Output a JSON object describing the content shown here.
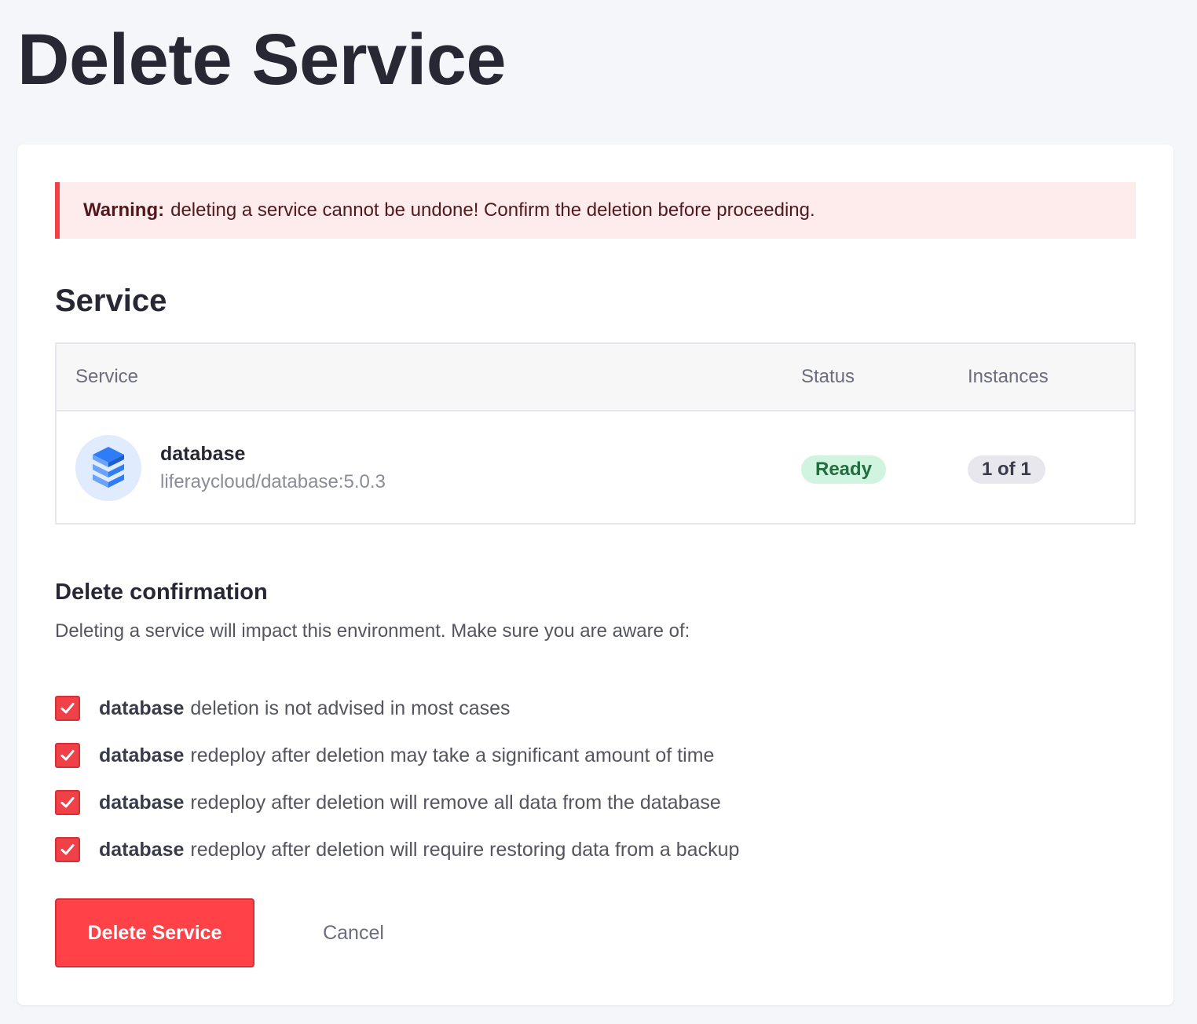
{
  "page": {
    "title": "Delete Service"
  },
  "alert": {
    "label": "Warning:",
    "message": "deleting a service cannot be undone! Confirm the deletion before proceeding."
  },
  "section": {
    "title": "Service"
  },
  "table": {
    "headers": {
      "service": "Service",
      "status": "Status",
      "instances": "Instances"
    },
    "row": {
      "icon": "database-stack-icon",
      "name": "database",
      "image": "liferaycloud/database:5.0.3",
      "status": "Ready",
      "instances": "1 of 1"
    }
  },
  "confirmation": {
    "title": "Delete confirmation",
    "description": "Deleting a service will impact this environment. Make sure you are aware of:",
    "items": [
      {
        "service": "database",
        "text": "deletion is not advised in most cases",
        "checked": true
      },
      {
        "service": "database",
        "text": "redeploy after deletion may take a significant amount of time",
        "checked": true
      },
      {
        "service": "database",
        "text": "redeploy after deletion will remove all data from the database",
        "checked": true
      },
      {
        "service": "database",
        "text": "redeploy after deletion will require restoring data from a backup",
        "checked": true
      }
    ]
  },
  "actions": {
    "delete_label": "Delete Service",
    "cancel_label": "Cancel"
  },
  "colors": {
    "page_background": "#f5f6fa",
    "danger": "#ff4148",
    "alert_background": "#feeced",
    "success_badge": "#d1f4e0",
    "success_text": "#226e3e",
    "avatar_background": "#e0ebfd",
    "icon_blue": "#2e7cf6"
  }
}
